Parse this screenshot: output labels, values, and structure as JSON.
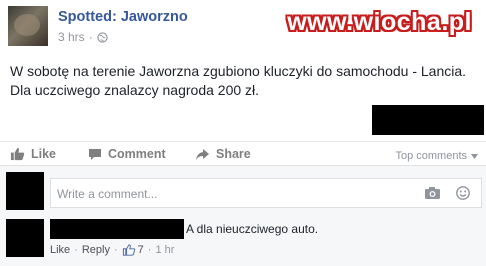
{
  "post": {
    "page_name": "Spotted: Jaworzno",
    "time": "3 hrs",
    "meta_separator": "·",
    "line1": "W sobotę na terenie Jaworzna zgubiono kluczyki do samochodu - Lancia.",
    "line2": "Dla uczciwego znalazcy nagroda 200 zł."
  },
  "watermark": "www.wiocha.pl",
  "actions": {
    "like": "Like",
    "comment": "Comment",
    "share": "Share",
    "top_comments": "Top comments"
  },
  "composer": {
    "placeholder": "Write a comment..."
  },
  "comment": {
    "text": "A dla nieuczciwego auto.",
    "like": "Like",
    "reply": "Reply",
    "reactions": "7",
    "time": "1 hr",
    "separator": "·"
  },
  "colors": {
    "link_blue": "#365899",
    "muted": "#90949c",
    "watermark_red": "#c81d1d"
  }
}
